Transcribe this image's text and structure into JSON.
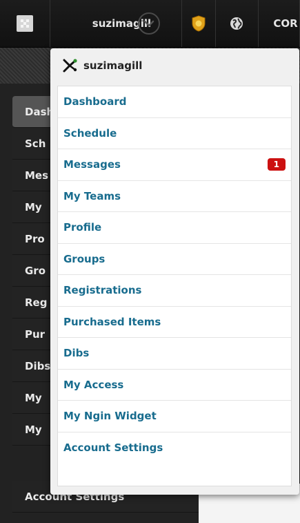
{
  "topbar": {
    "username": "suzimagill",
    "org_label": "COR",
    "icons": [
      "logo-icon",
      "chevron-down-icon",
      "shield-badge-icon",
      "globe-icon"
    ]
  },
  "sidebar": {
    "items": [
      {
        "label": "Dash",
        "active": true
      },
      {
        "label": "Sch"
      },
      {
        "label": "Mes"
      },
      {
        "label": "My"
      },
      {
        "label": "Pro"
      },
      {
        "label": "Gro"
      },
      {
        "label": "Reg"
      },
      {
        "label": "Pur"
      },
      {
        "label": "Dibs"
      },
      {
        "label": "My"
      },
      {
        "label": "My"
      },
      {
        "label": "Account Settings"
      }
    ]
  },
  "dropdown": {
    "header_name": "suzimagill",
    "items": [
      {
        "label": "Dashboard"
      },
      {
        "label": "Schedule"
      },
      {
        "label": "Messages",
        "badge": "1"
      },
      {
        "label": "My Teams"
      },
      {
        "label": "Profile"
      },
      {
        "label": "Groups"
      },
      {
        "label": "Registrations"
      },
      {
        "label": "Purchased Items"
      },
      {
        "label": "Dibs"
      },
      {
        "label": "My Access"
      },
      {
        "label": "My Ngin Widget"
      },
      {
        "label": "Account Settings"
      }
    ]
  },
  "colors": {
    "link": "#186c8e",
    "badge": "#cc1111",
    "topbar": "#151515"
  }
}
